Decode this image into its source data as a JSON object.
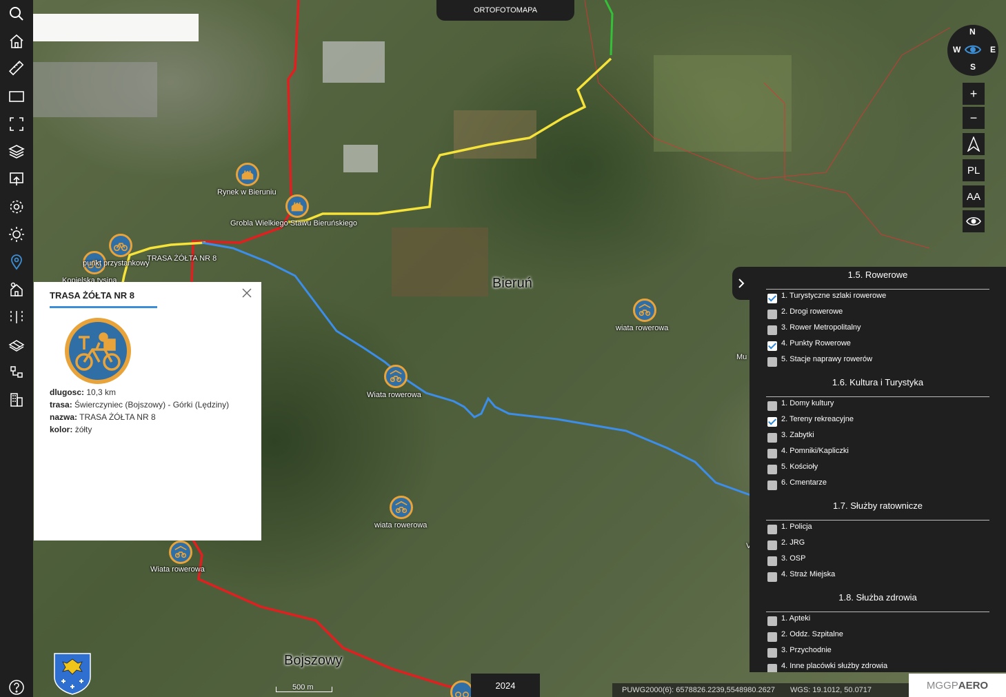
{
  "toolbar": {
    "items": [
      "search-icon",
      "home-icon",
      "ruler-icon",
      "rectangle-icon",
      "fullscreen-icon",
      "layers-icon",
      "export-icon",
      "settings-icon",
      "brightness-icon",
      "location-pin-icon",
      "building-gear-icon",
      "split-icon",
      "map-plane-icon",
      "cables-icon",
      "buildings-icon"
    ],
    "help": "help-icon"
  },
  "map": {
    "layer_tab": "ORTOFOTOMAPA",
    "year": "2024",
    "towns": [
      "Bieruń",
      "Bojszowy"
    ],
    "labels": {
      "rynek": "Rynek w Bieruniu",
      "grobla": "Grobla Wielkiego Stawu Bieruńskiego",
      "punkt": "punkt przystankowy",
      "trasa_label": "TRASA ŻÓŁTA NR 8",
      "kopiec": "Kopielska tysina",
      "wiata1": "wiata rowerowa",
      "wiata2": "Wiata rowerowa",
      "wiata3": "wiata rowerowa",
      "wiata4": "Wiata rowerowa",
      "mu": "Mu",
      "v": "V"
    },
    "scale": "500 m",
    "coords": {
      "puwg": "PUWG2000(6): 6578826.2239,5548980.2627",
      "wgs": "WGS: 19.1012, 50.0717"
    },
    "brand_a": "MGGP",
    "brand_b": "AERO",
    "colors": {
      "yellow_route": "#f5e23a",
      "red_route": "#e02020",
      "blue_route": "#3d8ee8",
      "green_route": "#35c03a"
    }
  },
  "compass": {
    "n": "N",
    "s": "S",
    "w": "W",
    "e": "E"
  },
  "controls": {
    "zoom_in": "+",
    "zoom_out": "−",
    "north": "north-arrow-icon",
    "lang": "PL",
    "font": "AA",
    "visibility": "eye-icon"
  },
  "popup": {
    "title": "TRASA ŻÓŁTA NR 8",
    "attrs": [
      {
        "key": "dlugosc:",
        "value": "10,3 km"
      },
      {
        "key": "trasa:",
        "value": "Świerczyniec (Bojszowy) - Górki (Lędziny)"
      },
      {
        "key": "nazwa:",
        "value": "TRASA ŻÓŁTA NR 8"
      },
      {
        "key": "kolor:",
        "value": "żółty"
      }
    ]
  },
  "panel": {
    "sections": [
      {
        "title": "1.5. Rowerowe",
        "items": [
          {
            "label": "1. Turystyczne szlaki rowerowe",
            "checked": true
          },
          {
            "label": "2. Drogi rowerowe",
            "checked": false
          },
          {
            "label": "3. Rower Metropolitalny",
            "checked": false
          },
          {
            "label": "4. Punkty Rowerowe",
            "checked": true
          },
          {
            "label": "5. Stacje naprawy rowerów",
            "checked": false
          }
        ]
      },
      {
        "title": "1.6. Kultura i Turystyka",
        "items": [
          {
            "label": "1. Domy kultury",
            "checked": false
          },
          {
            "label": "2. Tereny rekreacyjne",
            "checked": true
          },
          {
            "label": "3. Zabytki",
            "checked": false
          },
          {
            "label": "4. Pomniki/Kapliczki",
            "checked": false
          },
          {
            "label": "5. Kościoły",
            "checked": false
          },
          {
            "label": "6. Cmentarze",
            "checked": false
          }
        ]
      },
      {
        "title": "1.7. Służby ratownicze",
        "items": [
          {
            "label": "1. Policja",
            "checked": false
          },
          {
            "label": "2. JRG",
            "checked": false
          },
          {
            "label": "3. OSP",
            "checked": false
          },
          {
            "label": "4. Straż Miejska",
            "checked": false
          }
        ]
      },
      {
        "title": "1.8. Służba zdrowia",
        "items": [
          {
            "label": "1. Apteki",
            "checked": false
          },
          {
            "label": "2. Oddz. Szpitalne",
            "checked": false
          },
          {
            "label": "3. Przychodnie",
            "checked": false
          },
          {
            "label": "4. Inne placówki służby zdrowia",
            "checked": false
          }
        ]
      }
    ]
  }
}
